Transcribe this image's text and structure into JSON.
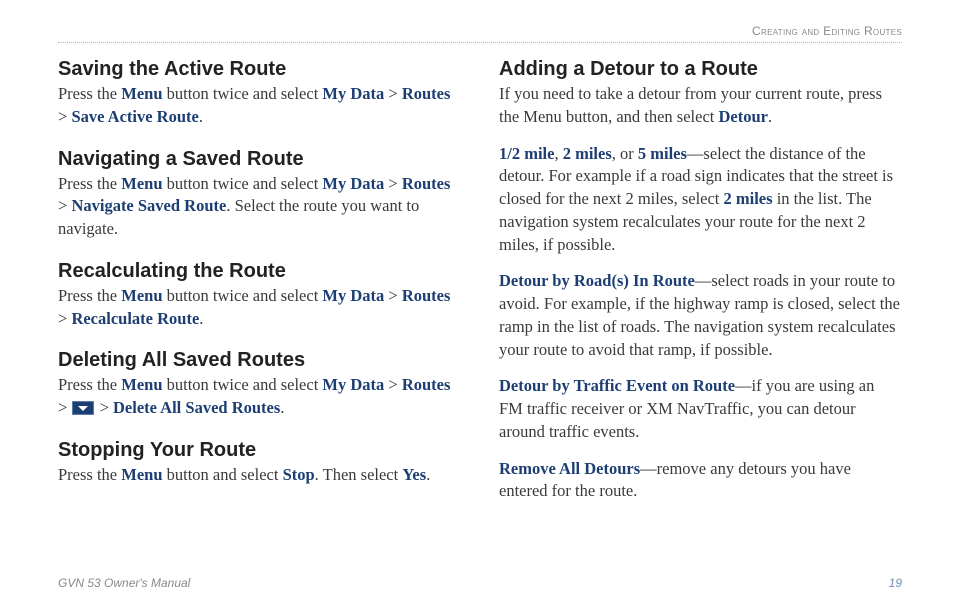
{
  "header": {
    "section_title": "Creating and Editing Routes"
  },
  "left": {
    "s1": {
      "heading": "Saving the Active Route",
      "t1": "Press the ",
      "b1": "Menu",
      "t2": " button twice and select ",
      "b2": "My Data",
      "gt1": " > ",
      "b3": "Routes",
      "gt2": " > ",
      "b4": "Save Active Route",
      "t3": "."
    },
    "s2": {
      "heading": "Navigating a Saved Route",
      "t1": "Press the ",
      "b1": "Menu",
      "t2": " button twice and select ",
      "b2": "My Data",
      "gt1": " > ",
      "b3": "Routes",
      "gt2": " > ",
      "b4": "Navigate Saved Route",
      "t3": ". Select the route you want to navigate."
    },
    "s3": {
      "heading": "Recalculating the Route",
      "t1": "Press the ",
      "b1": "Menu",
      "t2": " button twice and select ",
      "b2": "My Data",
      "gt1": " > ",
      "b3": "Routes",
      "gt2": " > ",
      "b4": "Recalculate Route",
      "t3": "."
    },
    "s4": {
      "heading": "Deleting All Saved Routes",
      "t1": "Press the ",
      "b1": "Menu",
      "t2": " button twice and select ",
      "b2": "My Data",
      "gt1": " > ",
      "b3": "Routes",
      "gt2": " > ",
      "gt3": " > ",
      "b5": "Delete All Saved Routes",
      "t3": "."
    },
    "s5": {
      "heading": "Stopping Your Route",
      "t1": "Press the ",
      "b1": "Menu",
      "t2": " button and select ",
      "b2": "Stop",
      "t3": ". Then select ",
      "b3": "Yes",
      "t4": "."
    }
  },
  "right": {
    "s1": {
      "heading": "Adding a Detour to a Route",
      "t1": "If you need to take a detour from your current route, press the Menu button, and then select ",
      "b1": "Detour",
      "t2": "."
    },
    "p2": {
      "b1": "1/2 mile",
      "c1": ", ",
      "b2": "2 miles",
      "c2": ", or ",
      "b3": "5 miles",
      "t1": "—select the distance of the detour. For example if a road sign indicates that the street is closed for the next 2 miles, select ",
      "b4": "2 miles",
      "t2": " in the list. The navigation system recalculates your route for the next 2 miles, if possible."
    },
    "p3": {
      "b1": "Detour by Road(s) In Route",
      "t1": "—select roads in your route to avoid. For example, if the highway ramp is closed, select the ramp in the list of roads. The navigation system recalculates your route to avoid that ramp, if possible."
    },
    "p4": {
      "b1": "Detour by Traffic Event on Route",
      "t1": "—if you are using an FM traffic receiver or XM NavTraffic, you can detour around traffic events."
    },
    "p5": {
      "b1": "Remove All Detours",
      "t1": "—remove any detours you have entered for the route."
    }
  },
  "footer": {
    "manual": "GVN 53 Owner's Manual",
    "page": "19"
  }
}
